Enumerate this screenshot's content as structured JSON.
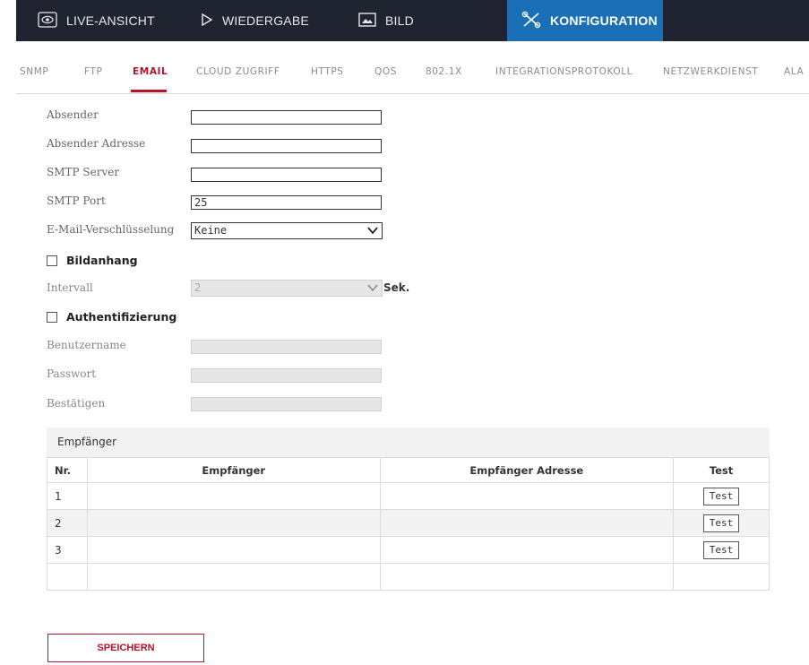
{
  "nav": {
    "items": [
      {
        "label": "LIVE-ANSICHT",
        "icon": "eye-icon"
      },
      {
        "label": "WIEDERGABE",
        "icon": "play-icon"
      },
      {
        "label": "BILD",
        "icon": "image-icon"
      },
      {
        "label": "KONFIGURATION",
        "icon": "tools-icon",
        "active": true
      }
    ],
    "active_color": "#1b6fb6",
    "bar_color": "#1f2430"
  },
  "subtabs": {
    "items": [
      "SNMP",
      "FTP",
      "EMAIL",
      "CLOUD ZUGRIFF",
      "HTTPS",
      "QOS",
      "802.1X",
      "INTEGRATIONSPROTOKOLL",
      "NETZWERKDIENST",
      "ALA"
    ],
    "active": "EMAIL",
    "active_color": "#b9122a"
  },
  "form": {
    "sender_label": "Absender",
    "sender_value": "",
    "sender_address_label": "Absender Adresse",
    "sender_address_value": "",
    "smtp_server_label": "SMTP Server",
    "smtp_server_value": "",
    "smtp_port_label": "SMTP Port",
    "smtp_port_value": "25",
    "encryption_label": "E-Mail-Verschlüsselung",
    "encryption_value": "Keine",
    "attachment_label": "Bildanhang",
    "attachment_checked": false,
    "interval_label": "Intervall",
    "interval_value": "2",
    "interval_unit": "Sek.",
    "auth_label": "Authentifizierung",
    "auth_checked": false,
    "username_label": "Benutzername",
    "password_label": "Passwort",
    "confirm_label": "Bestätigen"
  },
  "recipients": {
    "title": "Empfänger",
    "columns": [
      "Nr.",
      "Empfänger",
      "Empfänger Adresse",
      "Test"
    ],
    "rows": [
      {
        "nr": "1",
        "name": "",
        "address": "",
        "test_label": "Test"
      },
      {
        "nr": "2",
        "name": "",
        "address": "",
        "test_label": "Test"
      },
      {
        "nr": "3",
        "name": "",
        "address": "",
        "test_label": "Test"
      }
    ]
  },
  "save_label": "SPEICHERN"
}
